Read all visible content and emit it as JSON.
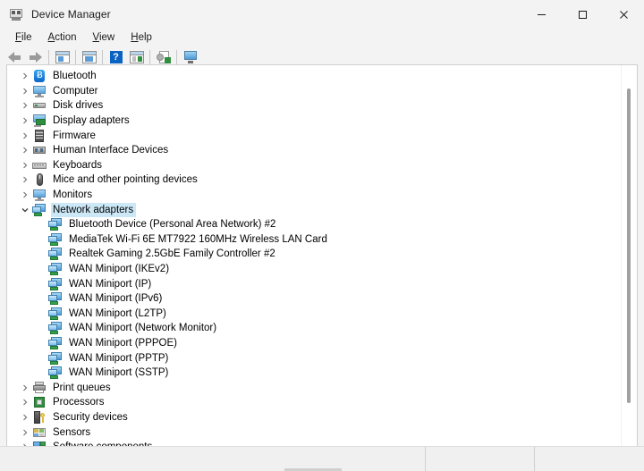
{
  "window": {
    "title": "Device Manager",
    "icon": "device-manager-icon",
    "controls": {
      "minimize": "Minimize",
      "maximize": "Maximize",
      "close": "Close"
    }
  },
  "menubar": {
    "items": [
      {
        "label": "File",
        "accel": "F"
      },
      {
        "label": "Action",
        "accel": "A"
      },
      {
        "label": "View",
        "accel": "V"
      },
      {
        "label": "Help",
        "accel": "H"
      }
    ]
  },
  "toolbar": {
    "buttons": [
      {
        "name": "back-button",
        "icon": "arrow-left-icon",
        "enabled": false
      },
      {
        "name": "forward-button",
        "icon": "arrow-right-icon",
        "enabled": false
      },
      {
        "name": "properties-button",
        "icon": "properties-icon",
        "enabled": true
      },
      {
        "name": "update-driver-button",
        "icon": "update-driver-icon",
        "enabled": true
      },
      {
        "name": "help-button",
        "icon": "help-icon",
        "enabled": true
      },
      {
        "name": "show-hidden-devices-button",
        "icon": "show-hidden-devices-icon",
        "enabled": true
      },
      {
        "name": "scan-for-hardware-changes-button",
        "icon": "scan-hardware-icon",
        "enabled": true
      },
      {
        "name": "display-button",
        "icon": "monitor-icon",
        "enabled": true
      }
    ]
  },
  "tree": {
    "selected": "Network adapters",
    "nodes": [
      {
        "label": "Bluetooth",
        "level": 0,
        "expanded": false,
        "icon": "bluetooth-icon",
        "iconClass": "ic-bluetooth"
      },
      {
        "label": "Computer",
        "level": 0,
        "expanded": false,
        "icon": "computer-icon",
        "iconClass": "ic-monitor"
      },
      {
        "label": "Disk drives",
        "level": 0,
        "expanded": false,
        "icon": "disk-drive-icon",
        "iconClass": "ic-disk"
      },
      {
        "label": "Display adapters",
        "level": 0,
        "expanded": false,
        "icon": "display-adapter-icon",
        "iconClass": "ic-display"
      },
      {
        "label": "Firmware",
        "level": 0,
        "expanded": false,
        "icon": "firmware-icon",
        "iconClass": "ic-firmware"
      },
      {
        "label": "Human Interface Devices",
        "level": 0,
        "expanded": false,
        "icon": "human-interface-device-icon",
        "iconClass": "ic-hid"
      },
      {
        "label": "Keyboards",
        "level": 0,
        "expanded": false,
        "icon": "keyboard-icon",
        "iconClass": "ic-keyboard"
      },
      {
        "label": "Mice and other pointing devices",
        "level": 0,
        "expanded": false,
        "icon": "mouse-icon",
        "iconClass": "ic-mouse"
      },
      {
        "label": "Monitors",
        "level": 0,
        "expanded": false,
        "icon": "monitor-icon",
        "iconClass": "ic-monitor"
      },
      {
        "label": "Network adapters",
        "level": 0,
        "expanded": true,
        "selected": true,
        "icon": "network-adapter-icon",
        "iconClass": "ic-net"
      },
      {
        "label": "Bluetooth Device (Personal Area Network) #2",
        "level": 1,
        "icon": "network-adapter-icon",
        "iconClass": "ic-net"
      },
      {
        "label": "MediaTek Wi-Fi 6E MT7922 160MHz Wireless LAN Card",
        "level": 1,
        "icon": "network-adapter-icon",
        "iconClass": "ic-net"
      },
      {
        "label": "Realtek Gaming 2.5GbE Family Controller #2",
        "level": 1,
        "icon": "network-adapter-icon",
        "iconClass": "ic-net"
      },
      {
        "label": "WAN Miniport (IKEv2)",
        "level": 1,
        "icon": "network-adapter-icon",
        "iconClass": "ic-net"
      },
      {
        "label": "WAN Miniport (IP)",
        "level": 1,
        "icon": "network-adapter-icon",
        "iconClass": "ic-net"
      },
      {
        "label": "WAN Miniport (IPv6)",
        "level": 1,
        "icon": "network-adapter-icon",
        "iconClass": "ic-net"
      },
      {
        "label": "WAN Miniport (L2TP)",
        "level": 1,
        "icon": "network-adapter-icon",
        "iconClass": "ic-net"
      },
      {
        "label": "WAN Miniport (Network Monitor)",
        "level": 1,
        "icon": "network-adapter-icon",
        "iconClass": "ic-net"
      },
      {
        "label": "WAN Miniport (PPPOE)",
        "level": 1,
        "icon": "network-adapter-icon",
        "iconClass": "ic-net"
      },
      {
        "label": "WAN Miniport (PPTP)",
        "level": 1,
        "icon": "network-adapter-icon",
        "iconClass": "ic-net"
      },
      {
        "label": "WAN Miniport (SSTP)",
        "level": 1,
        "icon": "network-adapter-icon",
        "iconClass": "ic-net"
      },
      {
        "label": "Print queues",
        "level": 0,
        "expanded": false,
        "icon": "printer-icon",
        "iconClass": "ic-printer"
      },
      {
        "label": "Processors",
        "level": 0,
        "expanded": false,
        "icon": "processor-icon",
        "iconClass": "ic-cpu"
      },
      {
        "label": "Security devices",
        "level": 0,
        "expanded": false,
        "icon": "security-device-icon",
        "iconClass": "ic-security"
      },
      {
        "label": "Sensors",
        "level": 0,
        "expanded": false,
        "icon": "sensor-icon",
        "iconClass": "ic-sensor"
      },
      {
        "label": "Software components",
        "level": 0,
        "expanded": false,
        "icon": "software-component-icon",
        "iconClass": "ic-software"
      }
    ]
  },
  "scrollbar": {
    "name": "vertical-scrollbar"
  },
  "statusbar": {
    "panels": [
      "",
      "",
      ""
    ]
  },
  "colors": {
    "selection": "#cce8f7",
    "chrome": "#f3f3f3",
    "content": "#ffffff",
    "accent_blue": "#0a62c2",
    "accent_green": "#2f8f3f"
  }
}
